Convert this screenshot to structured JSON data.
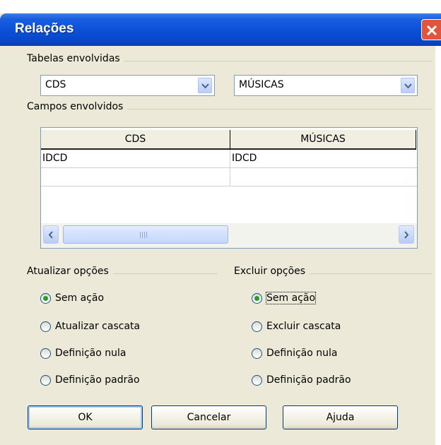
{
  "window": {
    "title": "Relações"
  },
  "tables_group": {
    "label": "Tabelas envolvidas",
    "left_combo": {
      "value": "CDS"
    },
    "right_combo": {
      "value": "MÚSICAS"
    }
  },
  "fields_group": {
    "label": "Campos envolvidos",
    "columns": [
      "CDS",
      "MÚSICAS"
    ],
    "rows": [
      [
        "IDCD",
        "IDCD"
      ],
      [
        "",
        ""
      ]
    ]
  },
  "update_options": {
    "label": "Atualizar opções",
    "options": [
      "Sem ação",
      "Atualizar cascata",
      "Definição nula",
      "Definição padrão"
    ],
    "selected": "Sem ação"
  },
  "delete_options": {
    "label": "Excluir opções",
    "options": [
      "Sem ação",
      "Excluir cascata",
      "Definição nula",
      "Definição padrão"
    ],
    "selected": "Sem ação"
  },
  "buttons": {
    "ok": "OK",
    "cancel": "Cancelar",
    "help": "Ajuda"
  },
  "icons": {
    "close": "close-icon",
    "dropdown": "chevron-down-icon",
    "scroll_left": "arrow-left-icon",
    "scroll_right": "arrow-right-icon"
  },
  "colors": {
    "titlebar": "#0a4fd6",
    "close_button": "#e2553a",
    "dialog_background": "#ece9d8",
    "radio_checked": "#21a121"
  }
}
